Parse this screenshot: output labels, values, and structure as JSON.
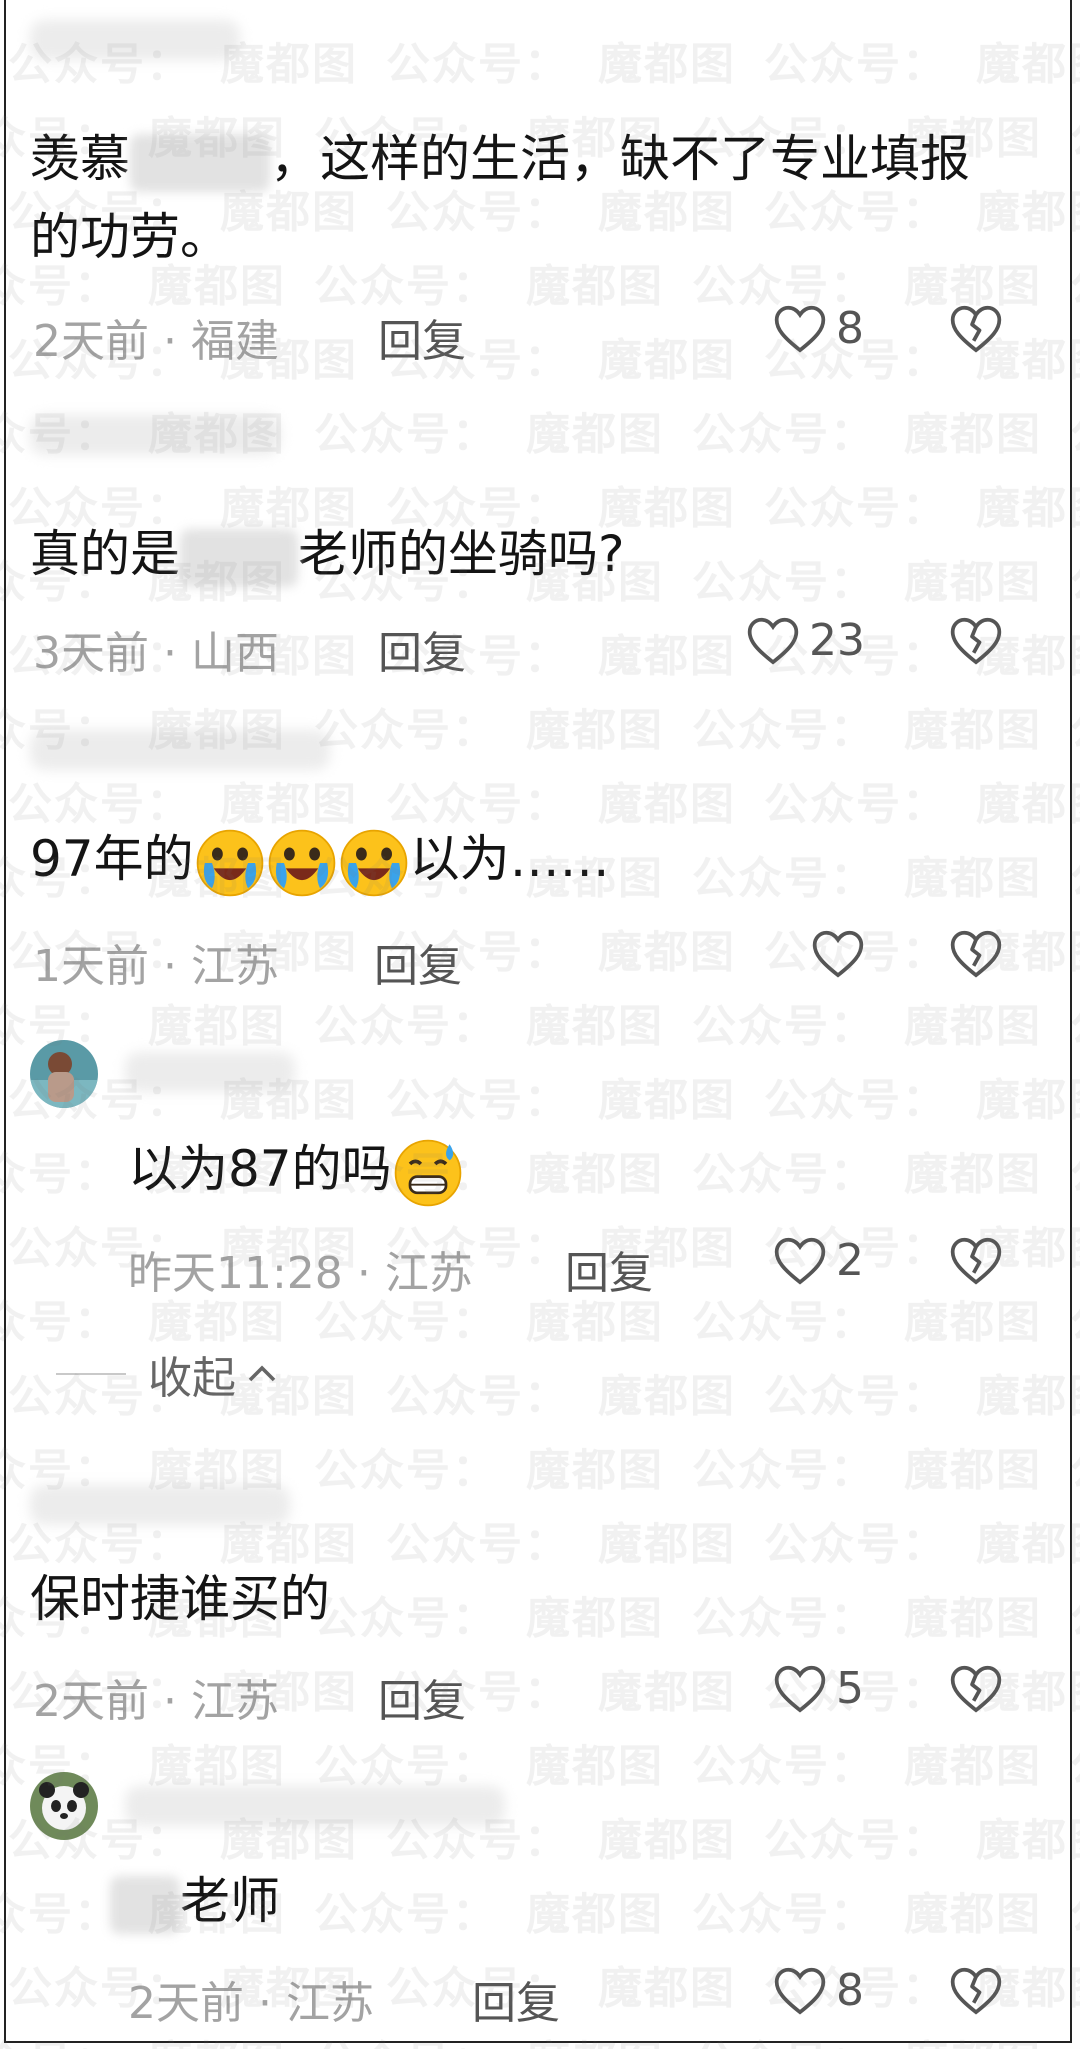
{
  "watermark": {
    "text_a": "公众号：",
    "text_b": "魔都图"
  },
  "comments": [
    {
      "text_before": "羡慕",
      "text_after": "，这样的生活，缺不了专业填报的功劳。",
      "time": "2天前",
      "region": "福建",
      "reply": "回复",
      "likes": "8"
    },
    {
      "text_before": "真的是",
      "text_after": "老师的坐骑吗?",
      "time": "3天前",
      "region": "山西",
      "reply": "回复",
      "likes": "23"
    },
    {
      "text_before": "97年的",
      "text_after": "以为……",
      "time": "1天前",
      "region": "江苏",
      "reply": "回复",
      "likes": ""
    },
    {
      "text": "以为87的吗",
      "time": "昨天11:28",
      "region": "江苏",
      "reply": "回复",
      "likes": "2"
    },
    {
      "text": "保时捷谁买的",
      "time": "2天前",
      "region": "江苏",
      "reply": "回复",
      "likes": "5"
    },
    {
      "text": "老师",
      "time": "2天前",
      "region": "江苏",
      "reply": "回复",
      "likes": "8"
    }
  ],
  "collapse_label": "收起",
  "icons": {
    "like": "heart-outline-icon",
    "dislike": "broken-heart-icon",
    "collapse": "chevron-up-icon"
  }
}
